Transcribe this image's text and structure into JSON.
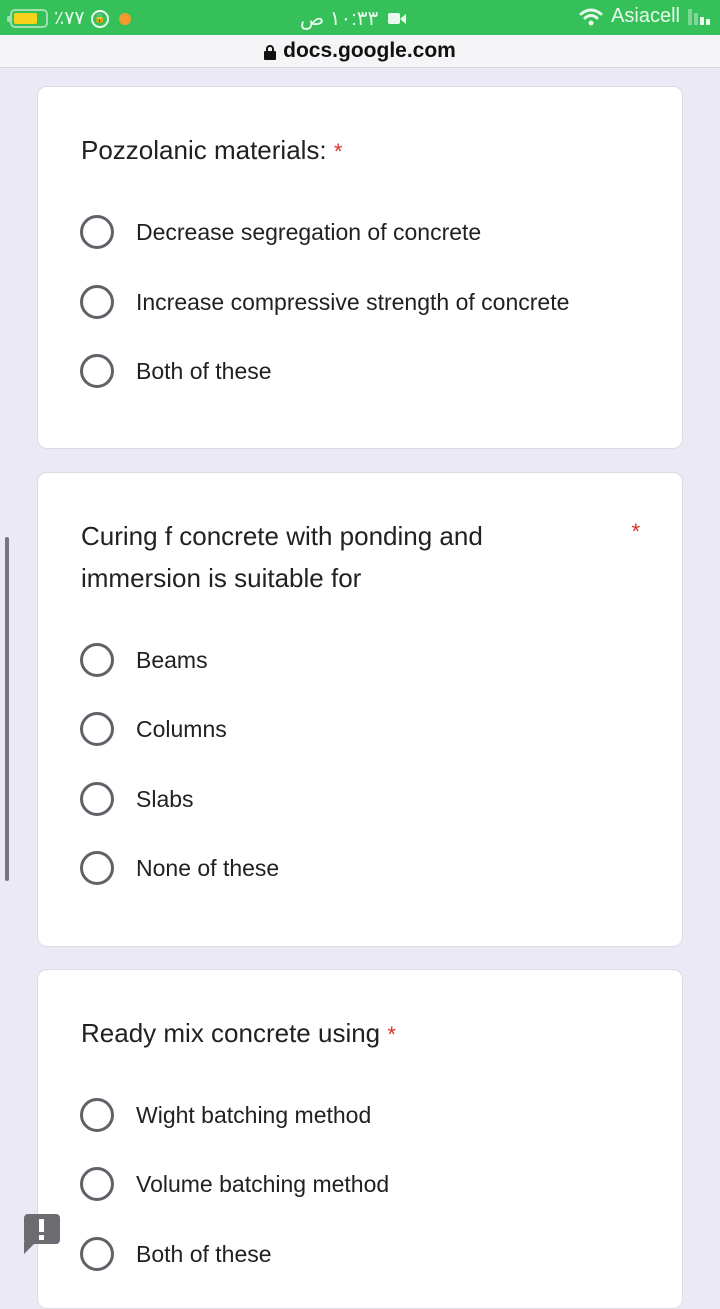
{
  "status_bar": {
    "battery_percent_text": "٪۷۷",
    "battery_level": 0.77,
    "time": "۱۰:۳۳ ص",
    "carrier": "Asiacell",
    "icons": [
      "battery-icon",
      "rotation-lock-icon",
      "recording-dot-icon",
      "video-camera-icon",
      "wifi-icon",
      "signal-icon"
    ],
    "colors": {
      "background": "#36c05a",
      "battery": "#f7d21b",
      "dot": "#f39a2c"
    }
  },
  "browser": {
    "url": "docs.google.com",
    "secure_icon": "lock-icon"
  },
  "form": {
    "required_marker": "*",
    "accent_required": "#d93025",
    "questions": [
      {
        "title": "Pozzolanic materials:",
        "required": true,
        "options": [
          "Decrease segregation of concrete",
          "Increase compressive strength of concrete",
          "Both of these"
        ]
      },
      {
        "title_line1": "Curing f concrete with ponding and",
        "title_line2": "immersion is suitable for",
        "required": true,
        "options": [
          "Beams",
          "Columns",
          "Slabs",
          "None of these"
        ]
      },
      {
        "title": "Ready mix concrete using",
        "required": true,
        "options": [
          "Wight batching method",
          "Volume batching method",
          "Both of these"
        ]
      }
    ]
  },
  "feedback": {
    "icon": "feedback-icon"
  }
}
